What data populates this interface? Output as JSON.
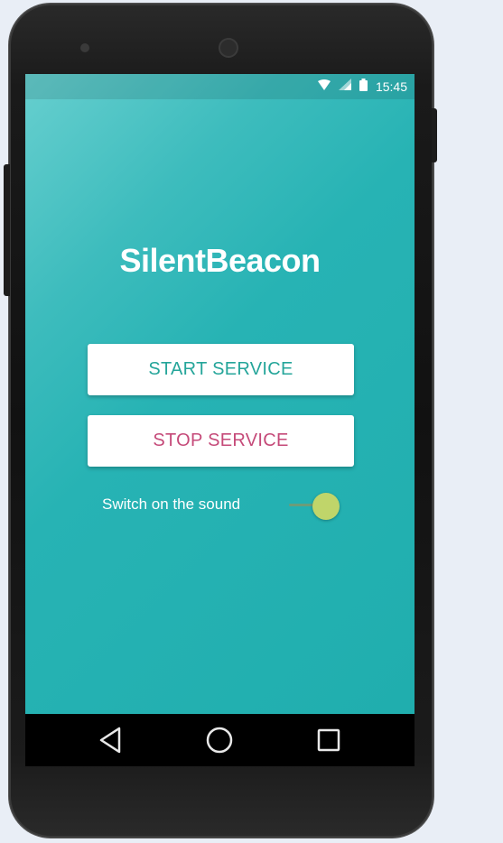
{
  "status_bar": {
    "time": "15:45",
    "icons": [
      "wifi-icon",
      "cellular-signal-icon",
      "battery-icon"
    ]
  },
  "app": {
    "title": "SilentBeacon",
    "start_button_label": "START SERVICE",
    "stop_button_label": "STOP SERVICE",
    "sound_switch_label": "Switch on the sound",
    "sound_switch_on": true
  },
  "nav_bar": {
    "icons": [
      "back-icon",
      "home-icon",
      "recents-icon"
    ]
  },
  "colors": {
    "background_accent": "#20aeae",
    "start_text": "#25a59a",
    "stop_text": "#c54a79",
    "switch_thumb": "#c0d56a"
  }
}
